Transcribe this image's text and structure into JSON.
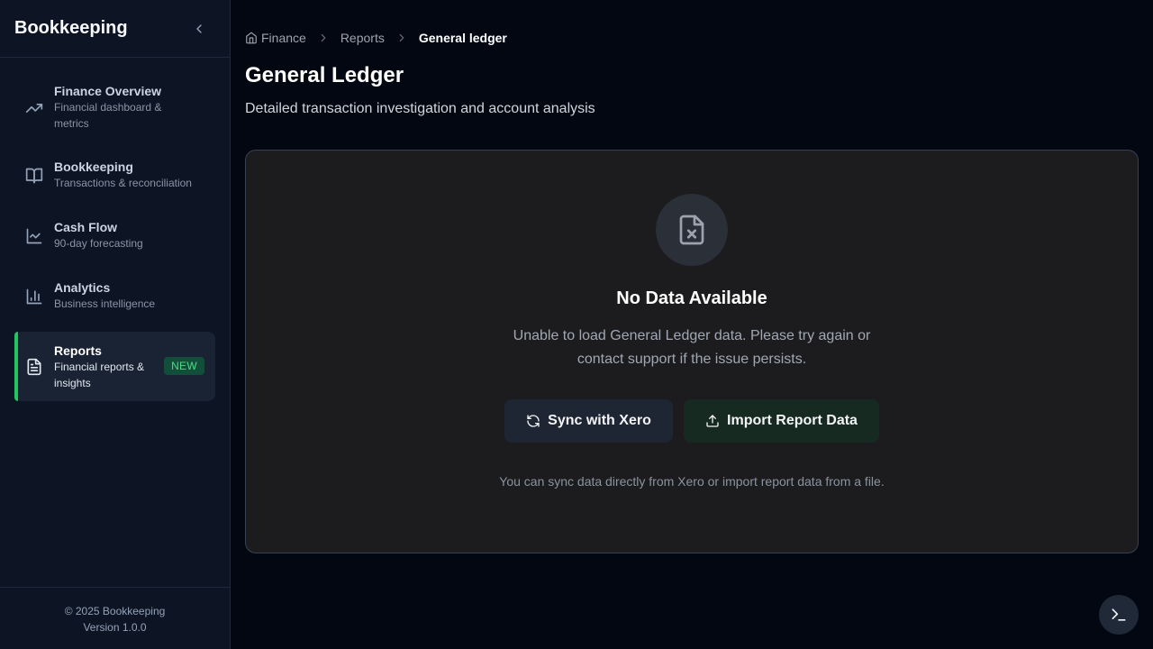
{
  "sidebar": {
    "title": "Bookkeeping",
    "items": [
      {
        "label": "Finance Overview",
        "sub": "Financial dashboard & metrics",
        "icon": "trending-up-icon"
      },
      {
        "label": "Bookkeeping",
        "sub": "Transactions & reconciliation",
        "icon": "book-open-icon"
      },
      {
        "label": "Cash Flow",
        "sub": "90-day forecasting",
        "icon": "line-chart-icon"
      },
      {
        "label": "Analytics",
        "sub": "Business intelligence",
        "icon": "bar-chart-icon"
      },
      {
        "label": "Reports",
        "sub": "Financial reports & insights",
        "icon": "file-text-icon",
        "badge": "NEW",
        "active": true
      }
    ],
    "footer": {
      "copyright": "© 2025 Bookkeeping",
      "version": "Version 1.0.0"
    }
  },
  "breadcrumb": [
    "Finance",
    "Reports",
    "General ledger"
  ],
  "page": {
    "title": "General Ledger",
    "description": "Detailed transaction investigation and account analysis"
  },
  "empty_state": {
    "icon": "file-x-icon",
    "title": "No Data Available",
    "message": "Unable to load General Ledger data. Please try again or contact support if the issue persists.",
    "sync_label": "Sync with Xero",
    "import_label": "Import Report Data",
    "hint": "You can sync data directly from Xero or import report data from a file."
  },
  "colors": {
    "accent": "#22c55e",
    "background": "#030712",
    "sidebar": "#0d1524",
    "card": "#1c1c1e"
  }
}
